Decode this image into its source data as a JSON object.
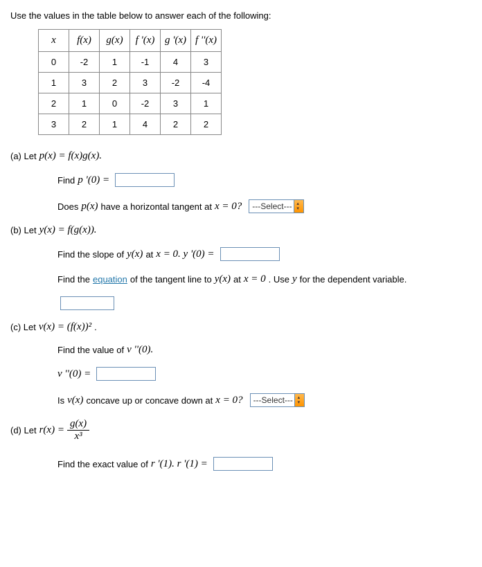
{
  "prompt": "Use the values in the table below to answer each of the following:",
  "table": {
    "headers": [
      "x",
      "f(x)",
      "g(x)",
      "f '(x)",
      "g '(x)",
      "f ''(x)"
    ],
    "rows": [
      [
        "0",
        "-2",
        "1",
        "-1",
        "4",
        "3"
      ],
      [
        "1",
        "3",
        "2",
        "3",
        "-2",
        "-4"
      ],
      [
        "2",
        "1",
        "0",
        "-2",
        "3",
        "1"
      ],
      [
        "3",
        "2",
        "1",
        "4",
        "2",
        "2"
      ]
    ]
  },
  "parts": {
    "a": {
      "label": "(a) Let ",
      "def": "p(x) = f(x)g(x).",
      "find": "Find ",
      "findExpr": "p '(0) =",
      "horiz1": "Does ",
      "horizExpr": "p(x)",
      "horiz2": " have a horizontal tangent at ",
      "horizAt": "x = 0?"
    },
    "b": {
      "label": "(b) Let ",
      "def": "y(x) = f(g(x)).",
      "slope1": "Find the slope of ",
      "slopeExpr1": "y(x)",
      "slope2": " at ",
      "slopeAt": "x = 0. y '(0) =",
      "tan1": "Find the ",
      "tanLink": "equation",
      "tan2": " of the tangent line to ",
      "tanExpr": "y(x)",
      "tan3": " at ",
      "tanAt": "x = 0",
      "tan4": ". Use ",
      "tanVar": "y",
      "tan5": " for the dependent variable."
    },
    "c": {
      "label": "(c) Let ",
      "def": "v(x) = (f(x))²",
      "period": ".",
      "find": "Find the value of ",
      "findExpr": "v ''(0).",
      "eq": "v ''(0) =",
      "conc1": "Is ",
      "concExpr": "v(x)",
      "conc2": " concave up or concave down at ",
      "concAt": "x = 0?"
    },
    "d": {
      "label": "(d) Let ",
      "rlhs": "r(x) = ",
      "num": "g(x)",
      "den": "x³",
      "find1": "Find the exact value of ",
      "findExpr": "r '(1). r '(1) ="
    }
  },
  "select": {
    "placeholder": "---Select---"
  }
}
